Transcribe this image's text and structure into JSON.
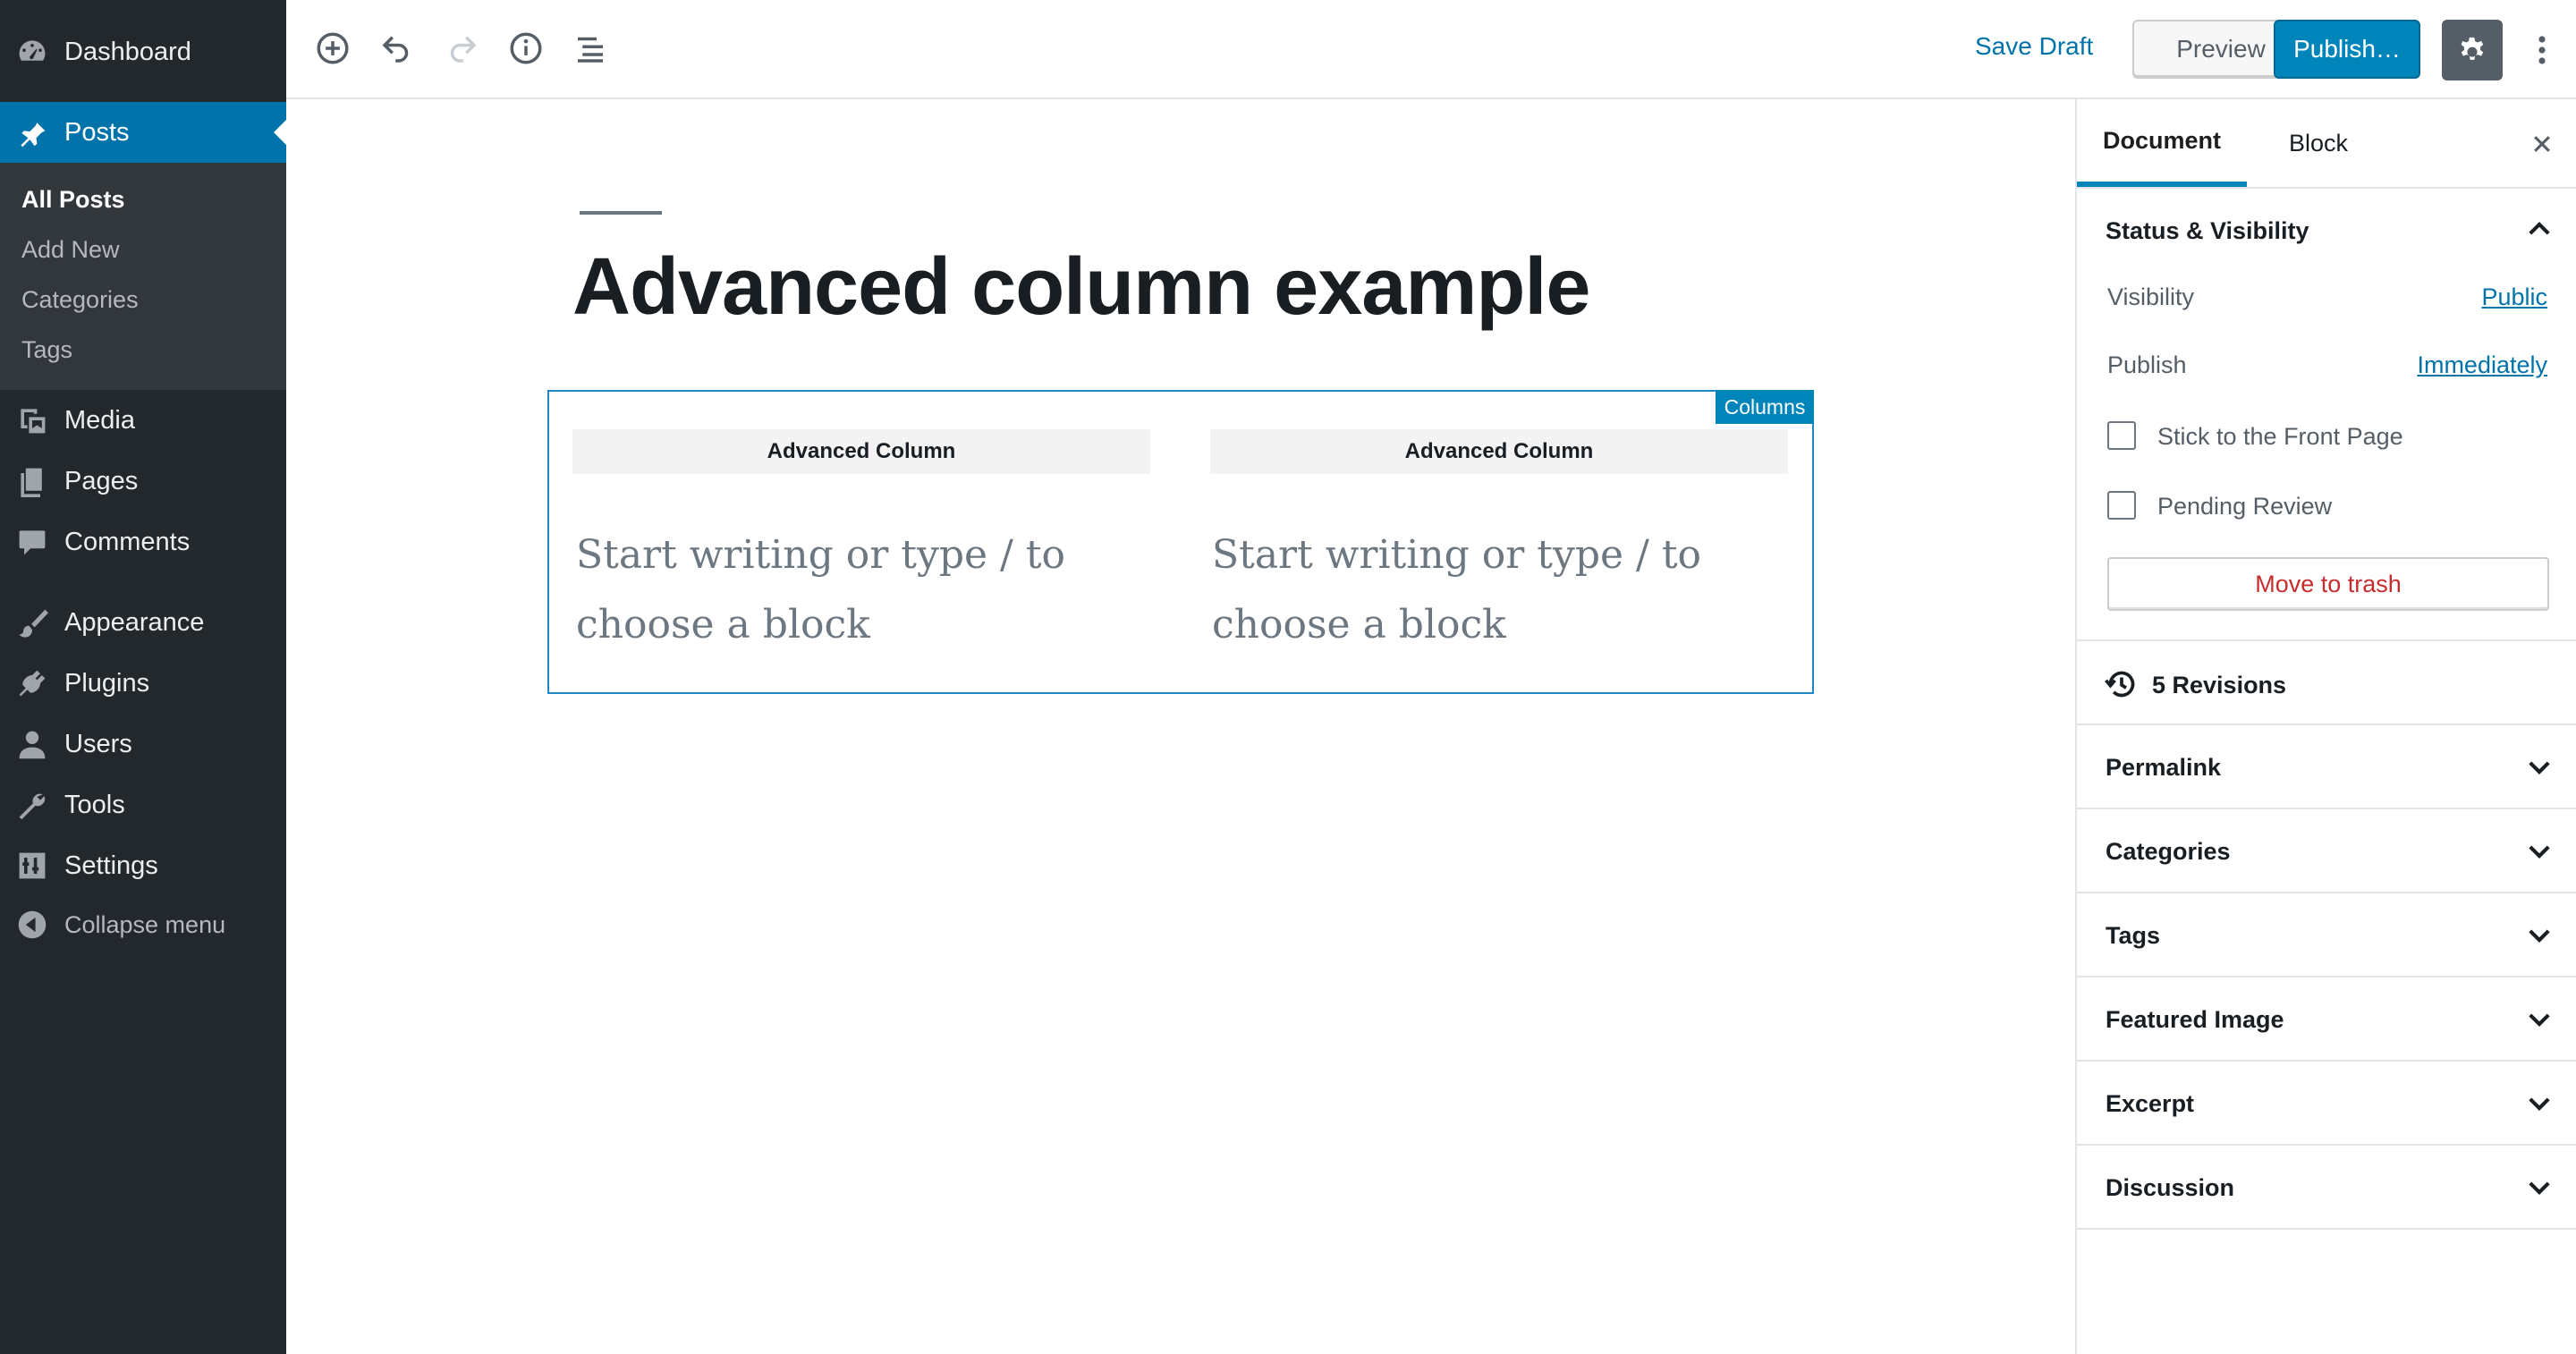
{
  "admin_menu": {
    "dashboard": "Dashboard",
    "posts": "Posts",
    "posts_submenu": [
      "All Posts",
      "Add New",
      "Categories",
      "Tags"
    ],
    "media": "Media",
    "pages": "Pages",
    "comments": "Comments",
    "appearance": "Appearance",
    "plugins": "Plugins",
    "users": "Users",
    "tools": "Tools",
    "settings": "Settings",
    "collapse": "Collapse menu"
  },
  "toolbar": {
    "save_draft": "Save Draft",
    "preview": "Preview",
    "publish": "Publish…",
    "icons": [
      "add-block-icon",
      "undo-icon",
      "redo-icon",
      "info-icon",
      "outline-icon",
      "gear-icon",
      "more-vertical-icon"
    ]
  },
  "editor": {
    "title": "Advanced column example",
    "block_badge": "Columns",
    "columns": [
      {
        "header": "Advanced Column",
        "placeholder_line1": "Start writing or type / to",
        "placeholder_line2": "choose a block"
      },
      {
        "header": "Advanced Column",
        "placeholder_line1": "Start writing or type / to",
        "placeholder_line2": "choose a block"
      }
    ]
  },
  "sidebar": {
    "tabs": [
      "Document",
      "Block"
    ],
    "status_visibility": {
      "title": "Status & Visibility",
      "visibility_label": "Visibility",
      "visibility_value": "Public",
      "publish_label": "Publish",
      "publish_value": "Immediately",
      "stick_label": "Stick to the Front Page",
      "pending_label": "Pending Review",
      "trash": "Move to trash"
    },
    "revisions": "5 Revisions",
    "panels": [
      "Permalink",
      "Categories",
      "Tags",
      "Featured Image",
      "Excerpt",
      "Discussion"
    ]
  },
  "colors": {
    "accent": "#0085ba",
    "admin_bg": "#23282d",
    "trash": "#c92c2c"
  }
}
